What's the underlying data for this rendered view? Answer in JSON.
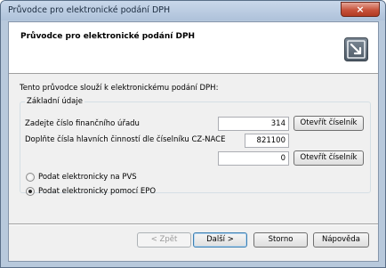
{
  "window": {
    "title": "Průvodce pro elektronické podání DPH",
    "close_glyph": "×"
  },
  "header": {
    "title": "Průvodce pro elektronické podání DPH",
    "icon": "wizard-arrow-icon"
  },
  "intro": "Tento průvodce slouží k elektronickému podání DPH:",
  "group": {
    "legend": "Základní údaje",
    "office_label": "Zadejte číslo finančního úřadu",
    "office_value": "314",
    "nace_label": "Doplňte čísla hlavních činností dle číselníku CZ-NACE",
    "nace_value": "821100",
    "nace_value2": "0",
    "open_codebook_label": "Otevřít číselník"
  },
  "options": [
    {
      "label": "Podat elektronicky na PVS",
      "selected": false
    },
    {
      "label": "Podat elektronicky pomocí EPO",
      "selected": true
    }
  ],
  "footer": {
    "back": "< Zpět",
    "next": "Další >",
    "cancel": "Storno",
    "help": "Nápověda"
  }
}
